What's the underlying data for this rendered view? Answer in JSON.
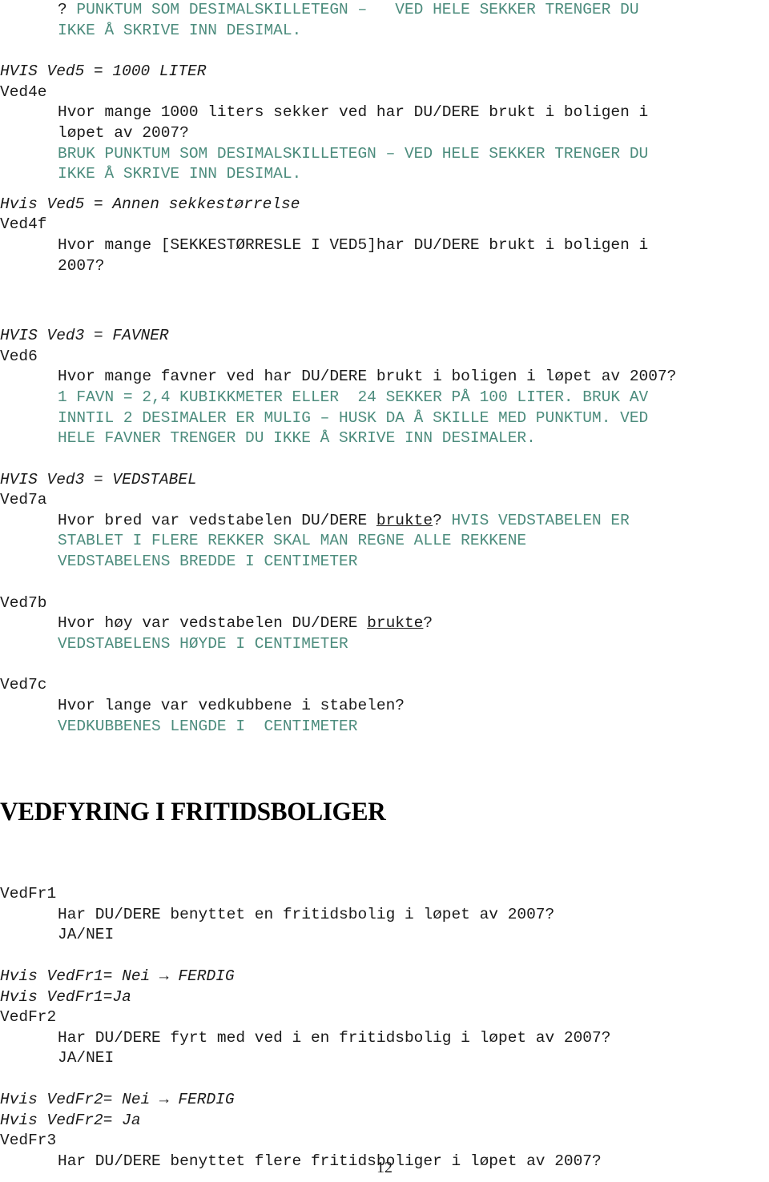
{
  "document": {
    "page_number": "12",
    "colors": {
      "body_text": "#1a1a1a",
      "instruction_text": "#4c8c7d",
      "background": "#ffffff"
    }
  },
  "blocks": {
    "ved4d_tail": {
      "lead_symbol": "? ",
      "hint_line1": "PUNKTUM SOM DESIMALSKILLETEGN –   VED HELE SEKKER TRENGER DU",
      "hint_line2": "IKKE Å SKRIVE INN DESIMAL."
    },
    "ved4e": {
      "condition": "HVIS Ved5 = 1000 LITER",
      "variable": "Ved4e",
      "question_line1": "Hvor mange 1000 liters sekker ved har DU/DERE brukt i boligen i",
      "question_line2": "løpet av 2007?",
      "hint_line1": "BRUK PUNKTUM SOM DESIMALSKILLETEGN – VED HELE SEKKER TRENGER DU",
      "hint_line2": "IKKE Å SKRIVE INN DESIMAL."
    },
    "ved4f": {
      "condition": "Hvis Ved5 = Annen sekkestørrelse",
      "variable": "Ved4f",
      "question_line1": "Hvor mange [SEKKESTØRRESLE I VED5]har DU/DERE brukt i boligen i",
      "question_line2": "2007?"
    },
    "ved6": {
      "condition": "HVIS Ved3 = FAVNER",
      "variable": "Ved6",
      "question_line1": "Hvor mange favner ved har DU/DERE brukt i boligen i løpet av 2007?",
      "hint_line1": "1 FAVN = 2,4 KUBIKKMETER ELLER  24 SEKKER PÅ 100 LITER. BRUK AV",
      "hint_line2": "INNTIL 2 DESIMALER ER MULIG – HUSK DA Å SKILLE MED PUNKTUM. VED",
      "hint_line3": "HELE FAVNER TRENGER DU IKKE Å SKRIVE INN DESIMALER."
    },
    "ved7a": {
      "condition": "HVIS Ved3 = VEDSTABEL",
      "variable": "Ved7a",
      "question_prefix": "Hvor bred var vedstabelen DU/DERE ",
      "question_underlined": "brukte",
      "question_suffix": "? ",
      "hint_inline": "HVIS VEDSTABELEN ER",
      "hint_line2": "STABLET I FLERE REKKER SKAL MAN REGNE ALLE REKKENE",
      "hint_line3": "VEDSTABELENS BREDDE I CENTIMETER"
    },
    "ved7b": {
      "variable": "Ved7b",
      "question_prefix": "Hvor høy var vedstabelen DU/DERE ",
      "question_underlined": "brukte",
      "question_suffix": "?",
      "hint_line1": "VEDSTABELENS HØYDE I CENTIMETER"
    },
    "ved7c": {
      "variable": "Ved7c",
      "question_line1": "Hvor lange var vedkubbene i stabelen?",
      "hint_line1": "VEDKUBBENES LENGDE I  CENTIMETER"
    },
    "section_heading": "VEDFYRING I FRITIDSBOLIGER",
    "vedfr1": {
      "variable": "VedFr1",
      "question_line1": "Har DU/DERE benyttet en fritidsbolig i løpet av 2007?",
      "answer_options": "JA/NEI"
    },
    "vedfr2": {
      "condition_line1": "Hvis VedFr1= Nei → FERDIG",
      "condition_line2": "Hvis VedFr1=Ja",
      "variable": "VedFr2",
      "question_line1": "Har DU/DERE fyrt med ved i en fritidsbolig i løpet av 2007?",
      "answer_options": "JA/NEI"
    },
    "vedfr3": {
      "condition_line1": "Hvis VedFr2= Nei → FERDIG",
      "condition_line2": "Hvis VedFr2= Ja",
      "variable": "VedFr3",
      "question_line1": "Har DU/DERE benyttet flere fritidsboliger i løpet av 2007?"
    }
  }
}
